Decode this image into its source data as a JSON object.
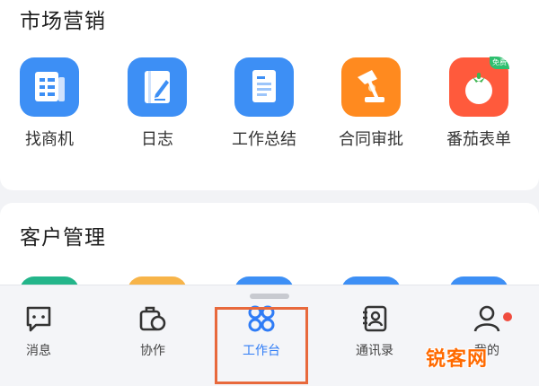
{
  "sections": {
    "market": {
      "title": "市场营销",
      "apps": [
        {
          "label": "找商机",
          "icon": "document-list-icon",
          "color": "#3d8ff5"
        },
        {
          "label": "日志",
          "icon": "notebook-pen-icon",
          "color": "#3d8ff5"
        },
        {
          "label": "工作总结",
          "icon": "report-icon",
          "color": "#3d8ff5"
        },
        {
          "label": "合同审批",
          "icon": "desk-lamp-icon",
          "color": "#ff8a1f"
        },
        {
          "label": "番茄表单",
          "icon": "tomato-icon",
          "color": "#ff5a3c",
          "badge": "免费"
        }
      ]
    },
    "customer": {
      "title": "客户管理",
      "apps": [
        {
          "icon": "app-icon",
          "color": "#23b58a"
        },
        {
          "icon": "app-icon",
          "color": "#f7b449"
        },
        {
          "icon": "app-icon",
          "color": "#3d8ff5"
        },
        {
          "icon": "app-icon",
          "color": "#3d8ff5"
        },
        {
          "icon": "app-icon",
          "color": "#3d8ff5"
        }
      ]
    }
  },
  "tabbar": {
    "tabs": [
      {
        "label": "消息",
        "icon": "message-icon"
      },
      {
        "label": "协作",
        "icon": "collaboration-icon"
      },
      {
        "label": "工作台",
        "icon": "workbench-icon",
        "active": true
      },
      {
        "label": "通讯录",
        "icon": "contacts-icon"
      },
      {
        "label": "我的",
        "icon": "profile-icon",
        "has_notification_dot": true
      }
    ],
    "active_color": "#2f7cf6"
  },
  "watermark": "锐客网"
}
